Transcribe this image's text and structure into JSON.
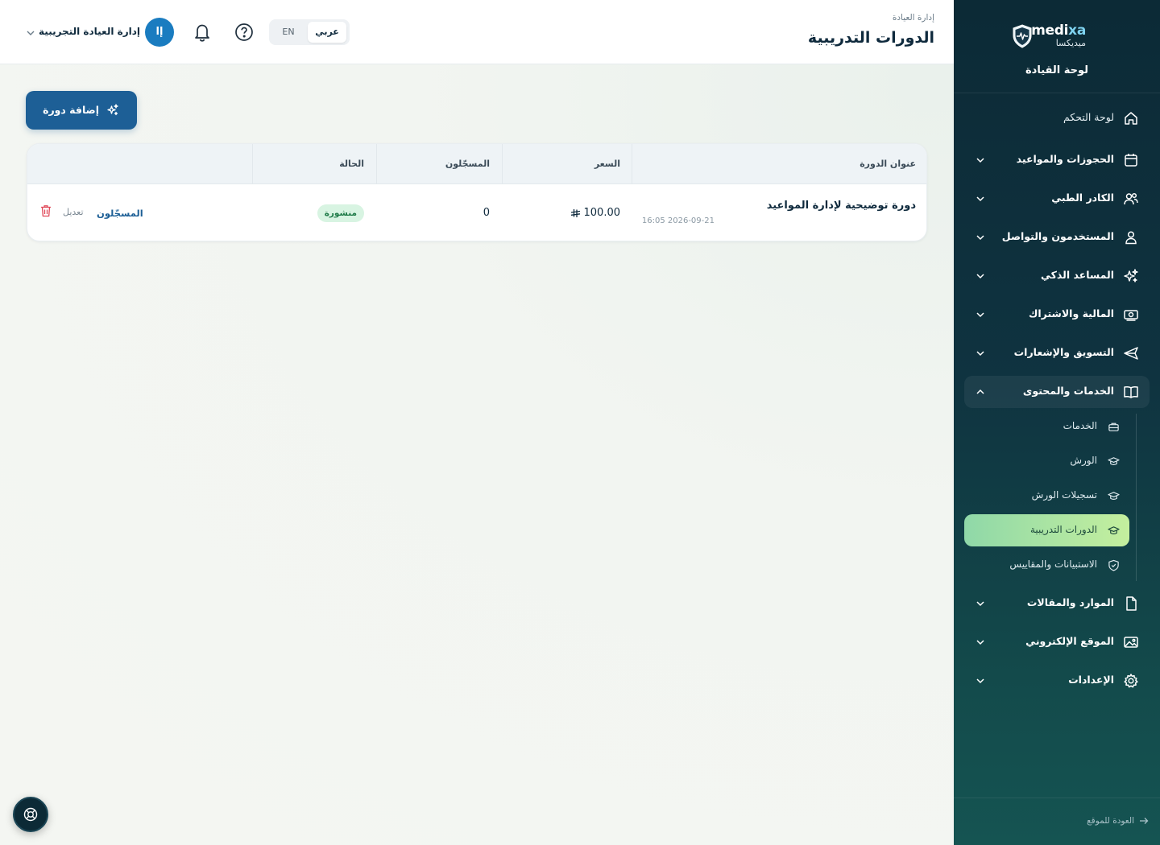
{
  "brand": {
    "name_prefix": "medi",
    "name_accent": "xa",
    "name_ar": "ميديكسا"
  },
  "sidebar": {
    "title": "لوحة القيادة",
    "items": [
      {
        "label": "لوحة التحكم",
        "icon": "home-icon"
      },
      {
        "label": "الحجوزات والمواعيد",
        "icon": "calendar-icon"
      },
      {
        "label": "الكادر الطبي",
        "icon": "users-icon"
      },
      {
        "label": "المستخدمون والتواصل",
        "icon": "user-icon"
      },
      {
        "label": "المساعد الذكي",
        "icon": "sparkles-icon"
      },
      {
        "label": "المالية والاشتراك",
        "icon": "money-icon"
      },
      {
        "label": "التسويق والإشعارات",
        "icon": "send-icon"
      },
      {
        "label": "الخدمات والمحتوى",
        "icon": "book-icon"
      },
      {
        "label": "الموارد والمقالات",
        "icon": "document-icon"
      },
      {
        "label": "الموقع الإلكتروني",
        "icon": "image-icon"
      },
      {
        "label": "الإعدادات",
        "icon": "gear-icon"
      }
    ],
    "sub_items": [
      {
        "label": "الخدمات",
        "icon": "briefcase-icon"
      },
      {
        "label": "الورش",
        "icon": "graduation-cap-icon"
      },
      {
        "label": "تسجيلات الورش",
        "icon": "graduation-cap-icon"
      },
      {
        "label": "الدورات التدريبية",
        "icon": "graduation-cap-icon"
      },
      {
        "label": "الاستبيانات والمقاييس",
        "icon": "shield-check-icon"
      }
    ],
    "back_link": "العودة للموقع"
  },
  "header": {
    "breadcrumb": "إدارة العيادة",
    "title": "الدورات التدريبية",
    "lang_ar": "عربي",
    "lang_en": "EN",
    "avatar_initials": "إا",
    "account_name": "إدارة العيادة التجريبية"
  },
  "main": {
    "add_button": "إضافة دورة",
    "table": {
      "columns": [
        "عنوان الدورة",
        "السعر",
        "المسجّلون",
        "الحالة"
      ],
      "rows": [
        {
          "title": "دورة توضيحية لإدارة المواعيد",
          "date": "2026-09-21 16:05",
          "price": "100.00",
          "enrolled": "0",
          "status": "منشورة",
          "action_enrolled": "المسجّلون",
          "action_edit": "تعديل"
        }
      ]
    }
  },
  "colors": {
    "sidebar_bg": "#0c2a36",
    "primary": "#1d5f96",
    "active_item": "#c4ef9e",
    "status_published_bg": "#d8f4e2",
    "status_published_text": "#1e7a47",
    "danger": "#e04a5a"
  }
}
